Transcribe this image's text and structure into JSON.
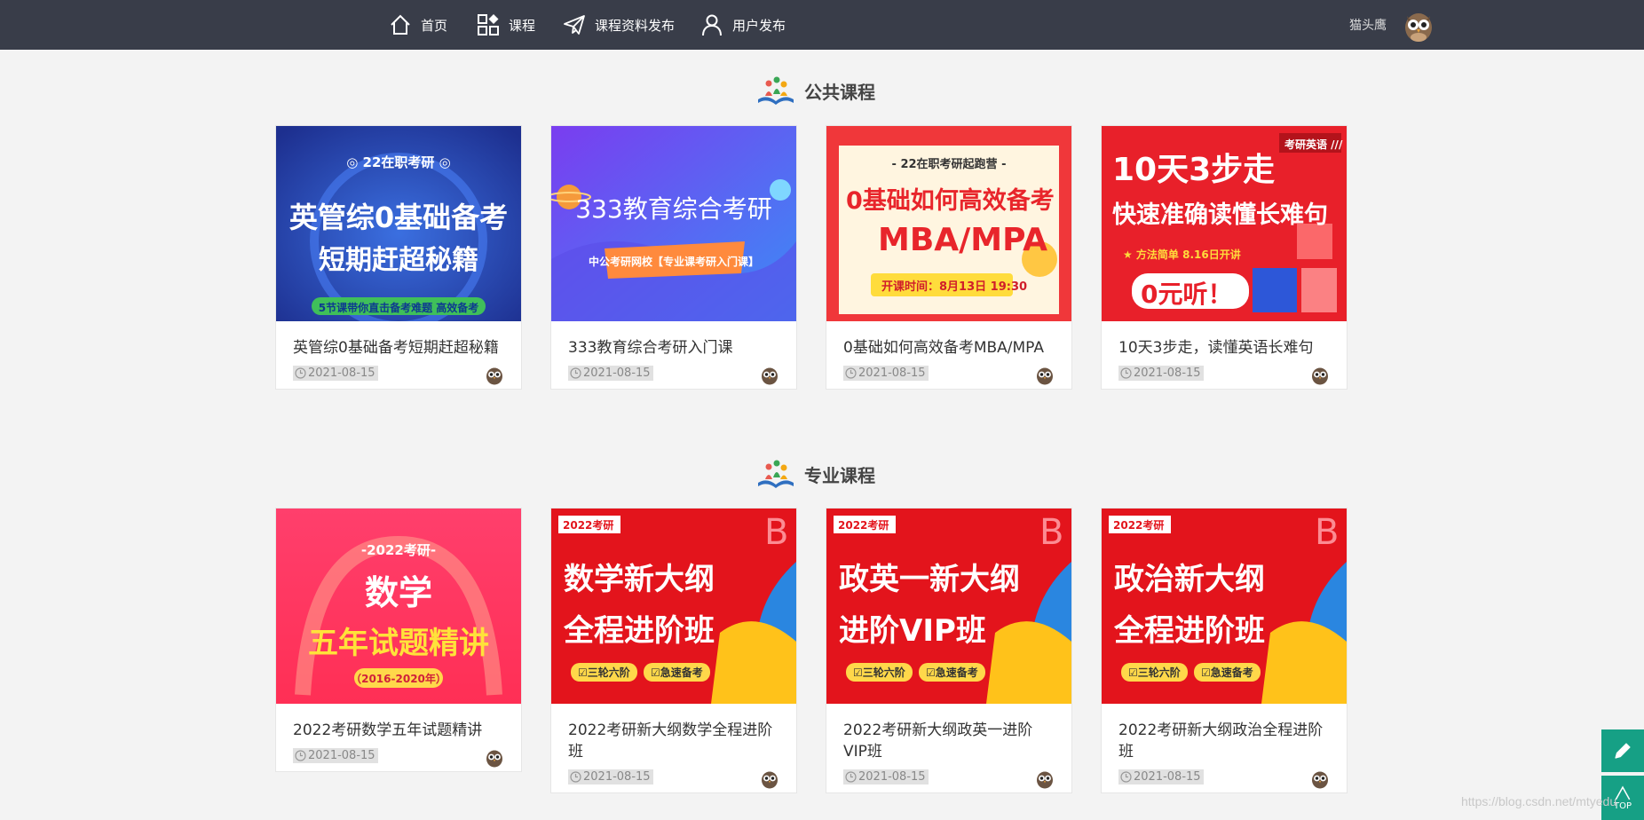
{
  "nav": {
    "items": [
      {
        "label": "首页",
        "icon": "home-icon"
      },
      {
        "label": "课程",
        "icon": "grid-icon"
      },
      {
        "label": "课程资料发布",
        "icon": "paper-plane-icon"
      },
      {
        "label": "用户发布",
        "icon": "user-icon"
      }
    ],
    "user_name": "猫头鹰"
  },
  "sections": [
    {
      "title": "公共课程",
      "courses": [
        {
          "title": "英管综0基础备考短期赶超秘籍",
          "date": "2021-08-15",
          "thumb": {
            "badge": "◎ 22在职考研 ◎",
            "line1": "英管综0基础备考",
            "line2": "短期赶超秘籍",
            "footer": "5节课带你直击备考难题  高效备考"
          }
        },
        {
          "title": "333教育综合考研入门课",
          "date": "2021-08-15",
          "thumb": {
            "line1": "333教育综合考研",
            "banner": "中公考研网校【专业课考研入门课】"
          }
        },
        {
          "title": "0基础如何高效备考MBA/MPA",
          "date": "2021-08-15",
          "thumb": {
            "badge": "- 22在职考研起跑营 -",
            "line1": "0基础如何高效备考",
            "line2": "MBA/MPA",
            "footer": "开课时间：8月13日 19:30"
          }
        },
        {
          "title": "10天3步走，读懂英语长难句",
          "date": "2021-08-15",
          "thumb": {
            "tag": "考研英语 ///",
            "line1": "10天3步走",
            "line2": "快速准确读懂长难句",
            "banner": "★ 方法简单 8.16日开讲",
            "footer": "0元听！"
          }
        }
      ]
    },
    {
      "title": "专业课程",
      "courses": [
        {
          "title": "2022考研数学五年试题精讲",
          "date": "2021-08-15",
          "thumb": {
            "badge": "-2022考研-",
            "line1": "数学",
            "line2": "五年试题精讲",
            "footer": "（2016-2020年）"
          }
        },
        {
          "title": "2022考研新大纲数学全程进阶班",
          "date": "2021-08-15",
          "thumb": {
            "tag": "2022考研",
            "line1": "数学新大纲",
            "line2": "全程进阶班",
            "chip1": "☑三轮六阶",
            "chip2": "☑急速备考"
          }
        },
        {
          "title": "2022考研新大纲政英一进阶VIP班",
          "date": "2021-08-15",
          "thumb": {
            "tag": "2022考研",
            "line1": "政英一新大纲",
            "line2": "进阶VIP班",
            "chip1": "☑三轮六阶",
            "chip2": "☑急速备考"
          }
        },
        {
          "title": "2022考研新大纲政治全程进阶班",
          "date": "2021-08-15",
          "thumb": {
            "tag": "2022考研",
            "line1": "政治新大纲",
            "line2": "全程进阶班",
            "chip1": "☑三轮六阶",
            "chip2": "☑急速备考"
          }
        }
      ]
    }
  ],
  "side_buttons": [
    {
      "icon": "pencil-icon"
    },
    {
      "icon": "arrow-up-icon",
      "label": "TOP"
    }
  ],
  "watermark": "https://blog.csdn.net/mtyedu",
  "colors": {
    "topbar": "#393d49",
    "accent": "#16a085",
    "page_bg": "#f3f3f3"
  }
}
